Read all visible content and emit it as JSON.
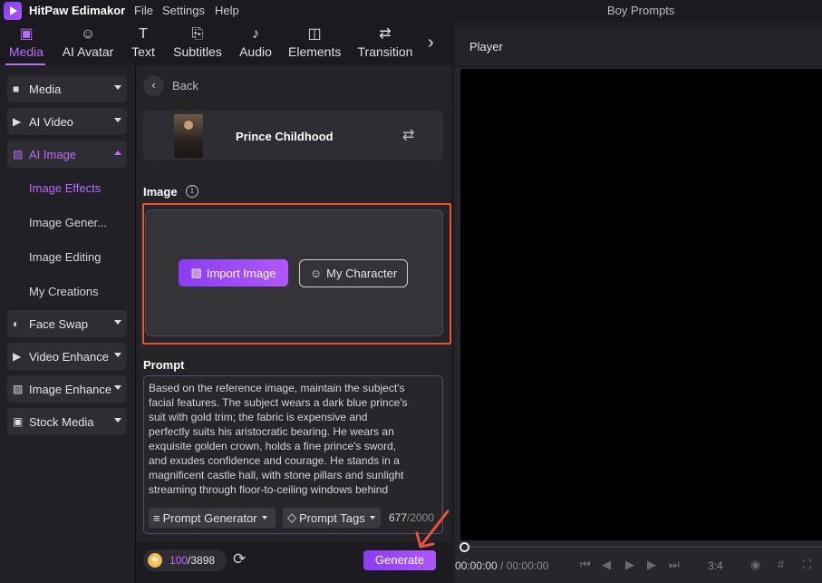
{
  "app": {
    "title": "HitPaw Edimakor",
    "document_title": "Boy Prompts",
    "menu": [
      "File",
      "Settings",
      "Help"
    ]
  },
  "toolbar": {
    "tabs": [
      {
        "label": "Media",
        "icon": "media-icon"
      },
      {
        "label": "AI Avatar",
        "icon": "avatar-icon"
      },
      {
        "label": "Text",
        "icon": "text-icon"
      },
      {
        "label": "Subtitles",
        "icon": "subtitles-icon"
      },
      {
        "label": "Audio",
        "icon": "audio-icon"
      },
      {
        "label": "Elements",
        "icon": "elements-icon"
      },
      {
        "label": "Transition",
        "icon": "transition-icon"
      }
    ],
    "active": "Media"
  },
  "sidebar": {
    "items": [
      {
        "label": "Media"
      },
      {
        "label": "AI Video"
      },
      {
        "label": "AI Image"
      },
      {
        "label": "Face Swap"
      },
      {
        "label": "Video Enhance"
      },
      {
        "label": "Image Enhance"
      },
      {
        "label": "Stock Media"
      }
    ],
    "subitems": [
      {
        "label": "Image Effects"
      },
      {
        "label": "Image Gener..."
      },
      {
        "label": "Image Editing"
      },
      {
        "label": "My Creations"
      }
    ]
  },
  "panel": {
    "back_label": "Back",
    "effect_name": "Prince Childhood",
    "image_label": "Image",
    "import_label": "Import Image",
    "character_label": "My Character",
    "prompt_label": "Prompt",
    "prompt_text": "Based on the reference image, maintain the subject's\nfacial features. The subject wears a dark blue prince's\nsuit with gold trim; the fabric is expensive and\nperfectly suits his aristocratic bearing. He wears an\nexquisite golden crown, holds a fine prince's sword,\nand exudes confidence and courage. He stands in a\nmagnificent castle hall, with stone pillars and sunlight\nstreaming through floor-to-ceiling windows behind",
    "prompt_generator_label": "Prompt Generator",
    "prompt_tags_label": "Prompt Tags",
    "char_count": "677",
    "char_max": "/2000",
    "credits_used": "100",
    "credits_total": "/3898",
    "coin_label": "AI",
    "generate_label": "Generate"
  },
  "player": {
    "title": "Player",
    "time_current": "00:00:00",
    "time_total": " / 00:00:00",
    "aspect_ratio": "3:4"
  },
  "colors": {
    "accent": "#b86bff",
    "highlight": "#e5553a",
    "button_gradient_start": "#8a3df5",
    "button_gradient_end": "#b057ff"
  }
}
